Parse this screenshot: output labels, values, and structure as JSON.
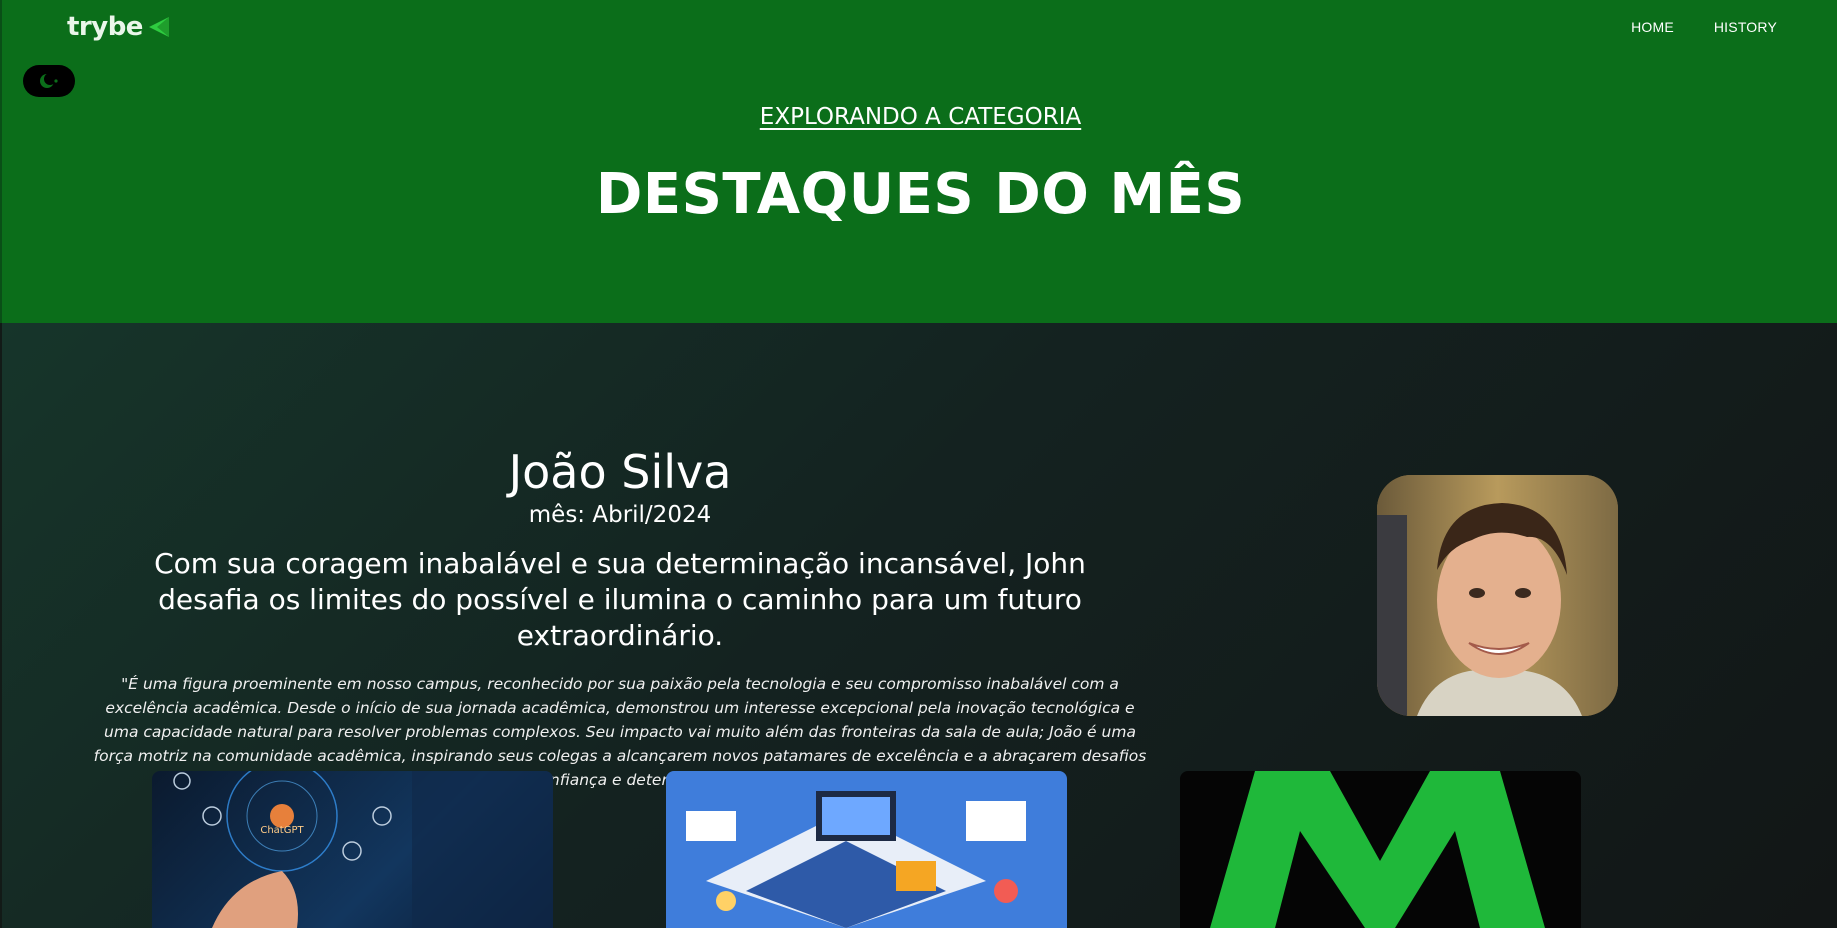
{
  "header": {
    "logo_text": "trybe",
    "nav": [
      "HOME",
      "HISTORY"
    ]
  },
  "hero": {
    "kicker": "EXPLORANDO A CATEGORIA",
    "title": "DESTAQUES DO MÊS"
  },
  "featured": {
    "name": "João Silva",
    "month": "mês: Abril/2024",
    "headline": "Com sua coragem inabalável e sua determinação incansável, John desafia os limites do possível e ilumina o caminho para um futuro extraordinário.",
    "quote": "\"É uma figura proeminente em nosso campus, reconhecido por sua paixão pela tecnologia e seu compromisso inabalável com a excelência acadêmica. Desde o início de sua jornada acadêmica, demonstrou um interesse excepcional pela inovação tecnológica e uma capacidade natural para resolver problemas complexos. Seu impacto vai muito além das fronteiras da sala de aula; João é uma força motriz na comunidade acadêmica, inspirando seus colegas a alcançarem novos patamares de excelência e a abraçarem desafios com confiança e determinação.\"",
    "photo_alt": "portrait photo"
  },
  "cards": [
    {
      "image": "chatgpt-ai-illustration",
      "label": "ChatGPT"
    },
    {
      "image": "isometric-tech-illustration"
    },
    {
      "image": "green-m-logo"
    }
  ],
  "colors": {
    "hero_bg": "#0b6e1a",
    "content_bg": "#142220",
    "toggle_bg": "#000000",
    "logo_accent": "#2ecc40"
  }
}
